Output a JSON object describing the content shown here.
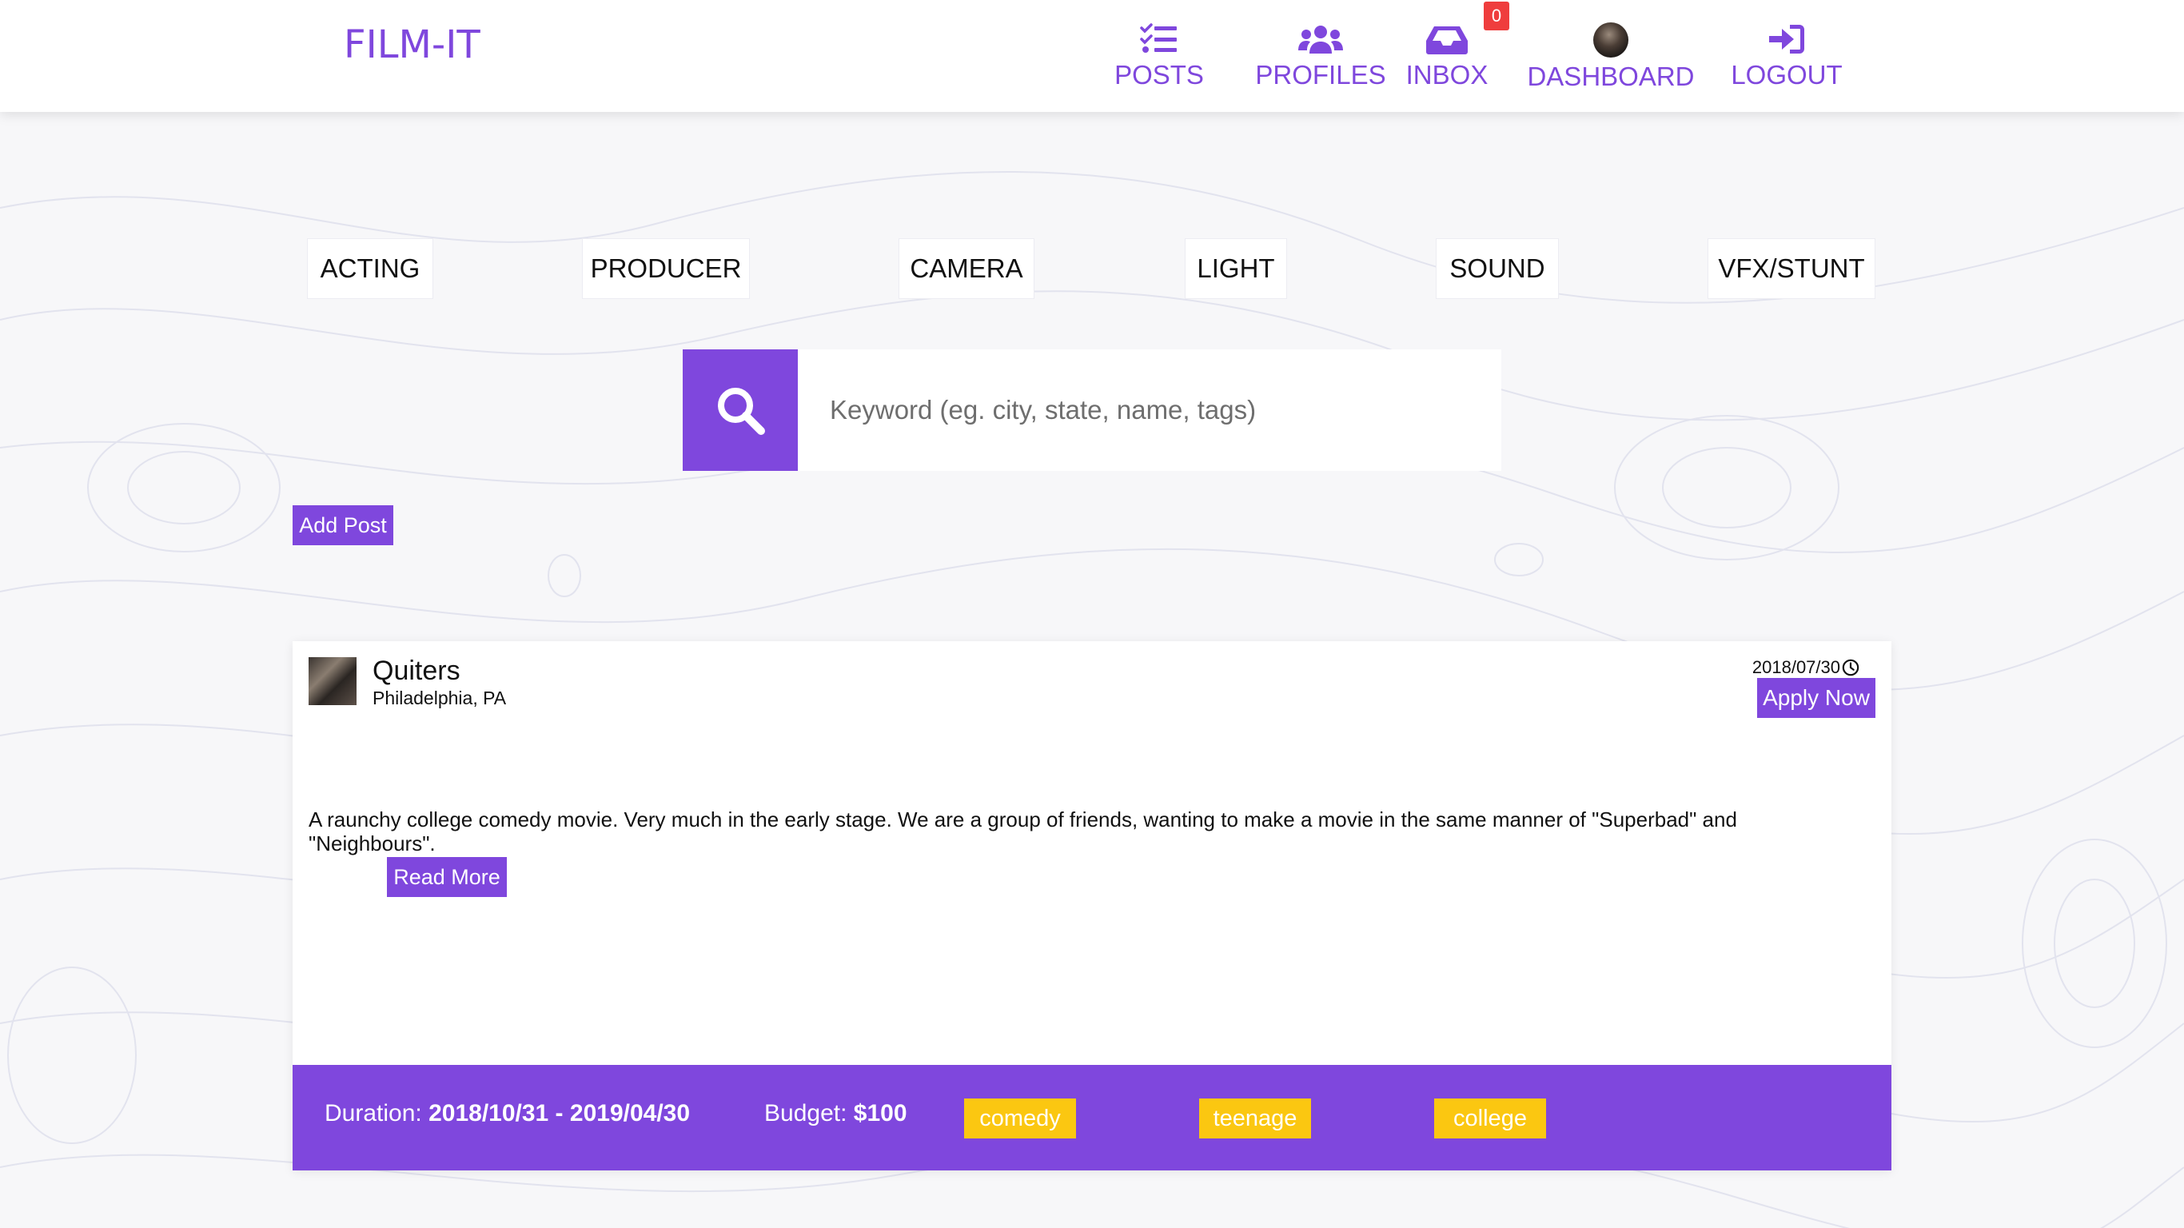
{
  "app": {
    "logo": "FILM-IT",
    "accent_color": "#7f47dd",
    "tag_color": "#fbc711",
    "badge_color": "#ef3d3d"
  },
  "nav": {
    "posts": {
      "label": "POSTS",
      "icon": "tasks-icon"
    },
    "profiles": {
      "label": "PROFILES",
      "icon": "users-icon"
    },
    "inbox": {
      "label": "INBOX",
      "icon": "inbox-icon",
      "badge": "0"
    },
    "dashboard": {
      "label": "DASHBOARD",
      "icon": "user-avatar"
    },
    "logout": {
      "label": "LOGOUT",
      "icon": "sign-in-icon"
    }
  },
  "categories": [
    "ACTING",
    "PRODUCER",
    "CAMERA",
    "LIGHT",
    "SOUND",
    "VFX/STUNT"
  ],
  "search": {
    "placeholder": "Keyword (eg. city, state, name, tags)",
    "icon": "search-icon"
  },
  "add_post_label": "Add Post",
  "post": {
    "title": "Quiters",
    "location": "Philadelphia, PA",
    "date": "2018/07/30",
    "apply_label": "Apply Now",
    "description": "A raunchy college comedy movie. Very much in the early stage. We are a group of friends, wanting to make a movie in the same manner of \"Superbad\" and \"Neighbours\".",
    "read_more_label": "Read More",
    "duration_label": "Duration:",
    "duration_value": "2018/10/31 - 2019/04/30",
    "budget_label": "Budget:",
    "budget_value": "$100",
    "tags": [
      "comedy",
      "teenage",
      "college"
    ]
  }
}
